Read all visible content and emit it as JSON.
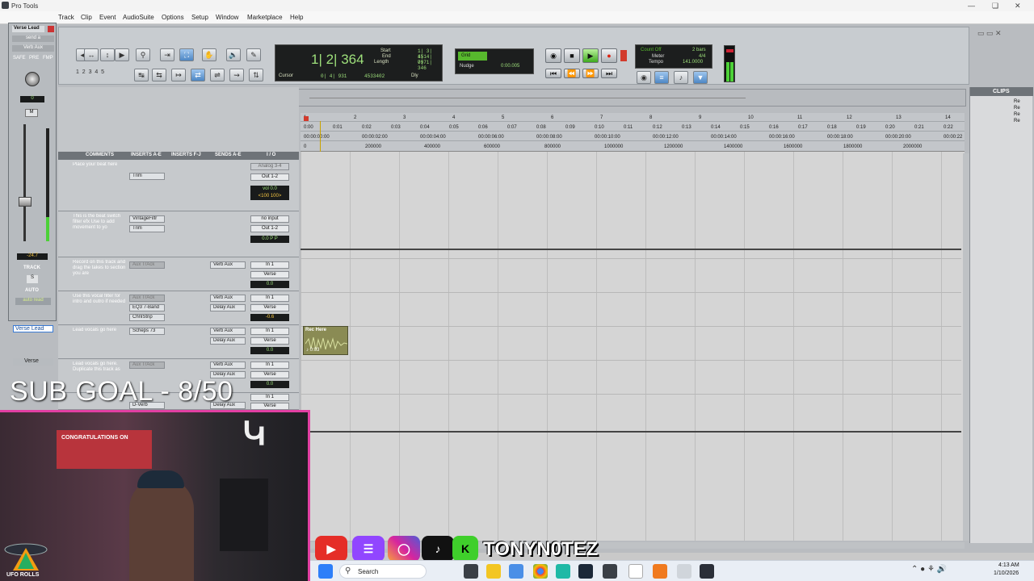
{
  "window": {
    "title": "Pro Tools"
  },
  "menu": [
    "Track",
    "Clip",
    "Event",
    "AudioSuite",
    "Options",
    "Setup",
    "Window",
    "Marketplace",
    "Help"
  ],
  "counter": {
    "main": "1| 2| 364",
    "start_label": "Start",
    "end_label": "End",
    "length_label": "Length",
    "start": "1| 3| 451",
    "end": "1| 4| 797",
    "length": "0| 1| 346",
    "cursor_label": "Cursor",
    "cursor": "0| 4| 931",
    "sample": "4533402",
    "dly": "Dly"
  },
  "grid": {
    "label": "Grid",
    "nudge_label": "Nudge",
    "nudge": "0:00.005"
  },
  "meter": {
    "count_off": "Count Off",
    "bars": "2 bars",
    "meter_label": "Meter",
    "meter": "4/4",
    "tempo_label": "Tempo",
    "tempo": "141.0000"
  },
  "mix": {
    "track_name": "Verse Lead",
    "send": "send a",
    "aux": "Verb Aux",
    "safe": "SAFE",
    "pre": "PRE",
    "fmp": "FMP",
    "pan": "0",
    "m": "M",
    "level": "-24.7",
    "track_label": "TRACK",
    "s": "S",
    "auto_label": "AUTO",
    "auto_mode": "auto read"
  },
  "columns": [
    "COMMENTS",
    "INSERTS A-E",
    "INSERTS F-J",
    "SENDS A-E",
    "I / O"
  ],
  "tracks": [
    {
      "comment": "Place your beat here",
      "inserts": [
        "Trim"
      ],
      "sends": [],
      "io": [
        "Analog 3-4",
        "Out 1-2"
      ],
      "vol": "vol 0.0",
      "pan": "<100 100>"
    },
    {
      "comment": "This is the beat switch filter efx Use to add movement to yo",
      "inserts": [
        "VintageFiltr",
        "Trim"
      ],
      "sends": [],
      "io": [
        "no input",
        "Out 1-2"
      ],
      "vol": "0.0  P  P"
    },
    {
      "comment": "Record on this track and drag the takes to section you are",
      "inserts": [
        "Aux TrAck"
      ],
      "sends": [
        "Verb Aux"
      ],
      "io": [
        "In 1",
        "Verse"
      ],
      "vol": "0.0"
    },
    {
      "comment": "Use this vocal filter for intro and outro if needed",
      "inserts": [
        "Aux TrAck",
        "EQ3 7-Band",
        "ChnlStrip"
      ],
      "sends": [
        "Verb Aux",
        "Delay Aux"
      ],
      "io": [
        "In 1",
        "Verse"
      ],
      "vol": "-0.6"
    },
    {
      "comment": "Lead vocals go here",
      "inserts": [
        "Scheps 73"
      ],
      "sends": [
        "Verb Aux",
        "Delay Aux"
      ],
      "io": [
        "In 1",
        "Verse"
      ],
      "vol": "0.0"
    },
    {
      "comment": "Lead vocals go here. Duplicate this track as",
      "inserts": [
        "Aux TrAck"
      ],
      "sends": [
        "Verb Aux",
        "Delay Aux"
      ],
      "io": [
        "In 1",
        "Verse"
      ],
      "vol": "0.0"
    },
    {
      "comment": "",
      "inserts": [
        "D-Verb"
      ],
      "sends": [
        "Delay Aux"
      ],
      "io": [
        "In 1",
        "Verse"
      ],
      "vol": ""
    }
  ],
  "track_names": [
    "Verse Lead",
    "Verse"
  ],
  "ruler": {
    "bars": [
      "1",
      "2",
      "3",
      "4",
      "5",
      "6",
      "7",
      "8",
      "9",
      "10",
      "11",
      "12",
      "13",
      "14"
    ],
    "minsecs": [
      "0:00",
      "0:01",
      "0:02",
      "0:03",
      "0:04",
      "0:05",
      "0:06",
      "0:07",
      "0:08",
      "0:09",
      "0:10",
      "0:11",
      "0:12",
      "0:13",
      "0:14",
      "0:15",
      "0:16",
      "0:17",
      "0:18",
      "0:19",
      "0:20",
      "0:21",
      "0:22"
    ],
    "timecode": [
      "00:00:00:00",
      "00:00:02:00",
      "00:00:04:00",
      "00:00:06:00",
      "00:00:08:00",
      "00:00:10:00",
      "00:00:12:00",
      "00:00:14:00",
      "00:00:16:00",
      "00:00:18:00",
      "00:00:20:00",
      "00:00:22"
    ],
    "samples": [
      "0",
      "200000",
      "400000",
      "600000",
      "800000",
      "1000000",
      "1200000",
      "1400000",
      "1600000",
      "1800000",
      "2000000"
    ]
  },
  "clip": {
    "name": "Rec Here",
    "sub": "♪ 0:03"
  },
  "clips_panel": {
    "title": "CLIPS",
    "items": [
      "Re",
      "Re",
      "Re",
      "Re"
    ]
  },
  "overlay": {
    "sub_goal": "SUB GOAL - 8/50",
    "handle": "TONYN0TEZ",
    "ufo": "UFO ROLLS",
    "banner": "CONGRATULATIONS ON"
  },
  "taskbar": {
    "search": "Search",
    "time": "4:13 AM",
    "date": "1/10/2026"
  }
}
